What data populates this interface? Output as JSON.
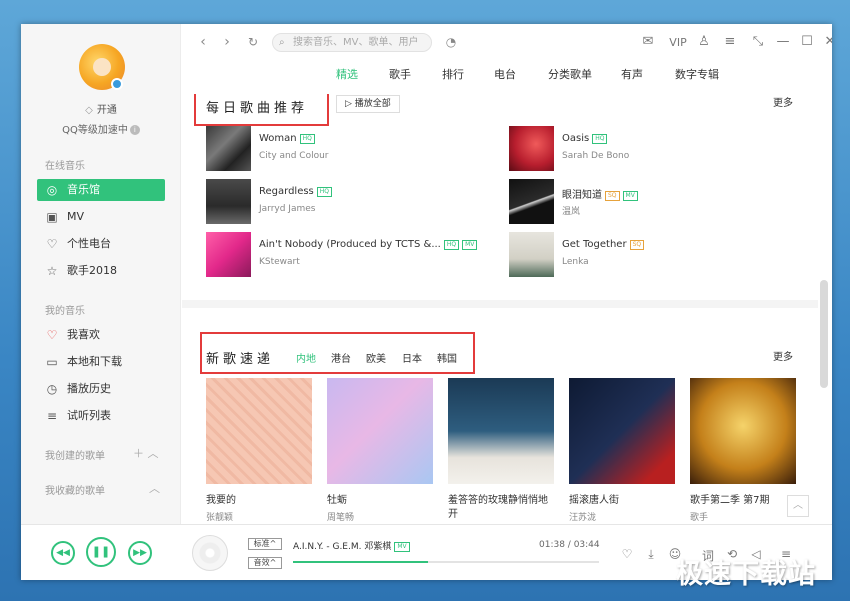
{
  "colors": {
    "accent": "#31c27c",
    "highlight_box": "#e33b3b",
    "sq_tag": "#e6a23c"
  },
  "user": {
    "vip_label": "开通",
    "level_label": "QQ等级加速中"
  },
  "sidebar": {
    "online_title": "在线音乐",
    "online_items": [
      {
        "label": "音乐馆",
        "icon": "music-hall-icon",
        "active": true
      },
      {
        "label": "MV",
        "icon": "mv-icon"
      },
      {
        "label": "个性电台",
        "icon": "radio-icon"
      },
      {
        "label": "歌手2018",
        "icon": "star-icon"
      }
    ],
    "mine_title": "我的音乐",
    "mine_items": [
      {
        "label": "我喜欢",
        "icon": "heart-icon"
      },
      {
        "label": "本地和下载",
        "icon": "monitor-icon"
      },
      {
        "label": "播放历史",
        "icon": "clock-icon"
      },
      {
        "label": "试听列表",
        "icon": "playlist-icon"
      }
    ],
    "created_title": "我创建的歌单",
    "favorite_title": "我收藏的歌单"
  },
  "topbar": {
    "search_placeholder": "搜索音乐、MV、歌单、用户",
    "vip": "VIP",
    "tabs": [
      "精选",
      "歌手",
      "排行",
      "电台",
      "分类歌单",
      "有声",
      "数字专辑"
    ],
    "active_tab": 0
  },
  "daily": {
    "title": "每日歌曲推荐",
    "play_all": "播放全部",
    "more": "更多",
    "songs": [
      {
        "title": "Woman",
        "artist": "City and Colour",
        "tags": [
          "HQ"
        ]
      },
      {
        "title": "Oasis",
        "artist": "Sarah De Bono",
        "tags": [
          "HQ"
        ]
      },
      {
        "title": "Regardless",
        "artist": "Jarryd James",
        "tags": [
          "HQ"
        ]
      },
      {
        "title": "眼泪知道",
        "artist": "温岚",
        "tags": [
          "SQ",
          "MV"
        ]
      },
      {
        "title": "Ain't Nobody (Produced by TCTS &...",
        "artist": "KStewart",
        "tags": [
          "HQ",
          "MV"
        ]
      },
      {
        "title": "Get Together",
        "artist": "Lenka",
        "tags": [
          "SQ"
        ]
      }
    ]
  },
  "new_songs": {
    "title": "新歌速递",
    "regions": [
      "内地",
      "港台",
      "欧美",
      "日本",
      "韩国"
    ],
    "active_region": 0,
    "more": "更多",
    "albums": [
      {
        "name": "我要的",
        "artist": "张靓颖"
      },
      {
        "name": "牡蛎",
        "artist": "周笔畅"
      },
      {
        "name": "羞答答的玫瑰静悄悄地开",
        "artist": "胡夏"
      },
      {
        "name": "摇滚唐人街",
        "artist": "汪苏泷"
      },
      {
        "name": "歌手第二季 第7期",
        "artist": "歌手"
      }
    ]
  },
  "player": {
    "quality": "标准",
    "effect": "音效",
    "now_playing": "A.I.N.Y. - G.E.M. 邓紫棋",
    "now_tag": "MV",
    "time": "01:38 / 03:44",
    "progress": 0.44
  },
  "watermark": "极速下载站"
}
